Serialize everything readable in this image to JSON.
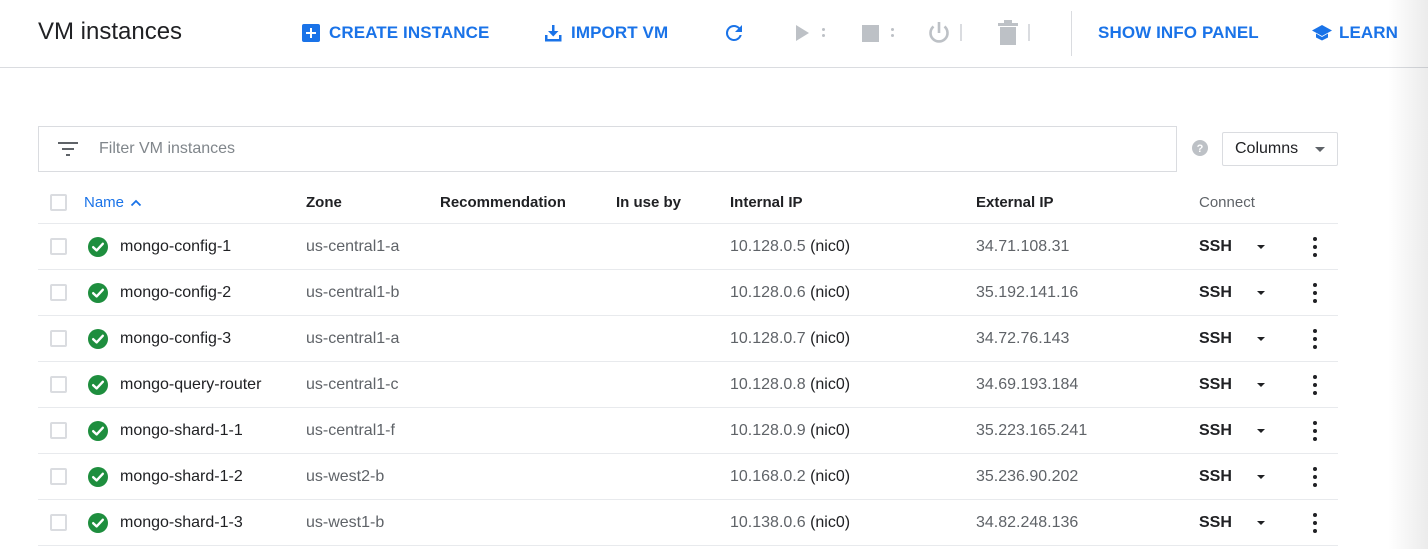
{
  "toolbar": {
    "title": "VM instances",
    "create_label": "CREATE INSTANCE",
    "import_label": "IMPORT VM",
    "info_panel_label": "SHOW INFO PANEL",
    "learn_label": "LEARN",
    "icons": [
      "add-box-icon",
      "import-icon",
      "refresh-icon",
      "play-icon",
      "stop-icon",
      "power-icon",
      "trash-icon",
      "school-icon"
    ],
    "accent_color": "#1a73e8",
    "disabled_color": "#bdc1c6"
  },
  "filter": {
    "placeholder": "Filter VM instances",
    "value": ""
  },
  "columns_button": {
    "label": "Columns"
  },
  "table": {
    "headers": {
      "name": "Name",
      "zone": "Zone",
      "recommendation": "Recommendation",
      "in_use_by": "In use by",
      "internal_ip": "Internal IP",
      "external_ip": "External IP",
      "connect": "Connect"
    },
    "sort": {
      "column": "name",
      "direction": "ascending"
    },
    "status_color": "#1e8e3e",
    "rows": [
      {
        "name": "mongo-config-1",
        "zone": "us-central1-a",
        "recommendation": "",
        "in_use_by": "",
        "internal_ip": "10.128.0.5",
        "nic": "(nic0)",
        "external_ip": "34.71.108.31",
        "connect": "SSH"
      },
      {
        "name": "mongo-config-2",
        "zone": "us-central1-b",
        "recommendation": "",
        "in_use_by": "",
        "internal_ip": "10.128.0.6",
        "nic": "(nic0)",
        "external_ip": "35.192.141.16",
        "connect": "SSH"
      },
      {
        "name": "mongo-config-3",
        "zone": "us-central1-a",
        "recommendation": "",
        "in_use_by": "",
        "internal_ip": "10.128.0.7",
        "nic": "(nic0)",
        "external_ip": "34.72.76.143",
        "connect": "SSH"
      },
      {
        "name": "mongo-query-router",
        "zone": "us-central1-c",
        "recommendation": "",
        "in_use_by": "",
        "internal_ip": "10.128.0.8",
        "nic": "(nic0)",
        "external_ip": "34.69.193.184",
        "connect": "SSH"
      },
      {
        "name": "mongo-shard-1-1",
        "zone": "us-central1-f",
        "recommendation": "",
        "in_use_by": "",
        "internal_ip": "10.128.0.9",
        "nic": "(nic0)",
        "external_ip": "35.223.165.241",
        "connect": "SSH"
      },
      {
        "name": "mongo-shard-1-2",
        "zone": "us-west2-b",
        "recommendation": "",
        "in_use_by": "",
        "internal_ip": "10.168.0.2",
        "nic": "(nic0)",
        "external_ip": "35.236.90.202",
        "connect": "SSH"
      },
      {
        "name": "mongo-shard-1-3",
        "zone": "us-west1-b",
        "recommendation": "",
        "in_use_by": "",
        "internal_ip": "10.138.0.6",
        "nic": "(nic0)",
        "external_ip": "34.82.248.136",
        "connect": "SSH"
      }
    ]
  }
}
